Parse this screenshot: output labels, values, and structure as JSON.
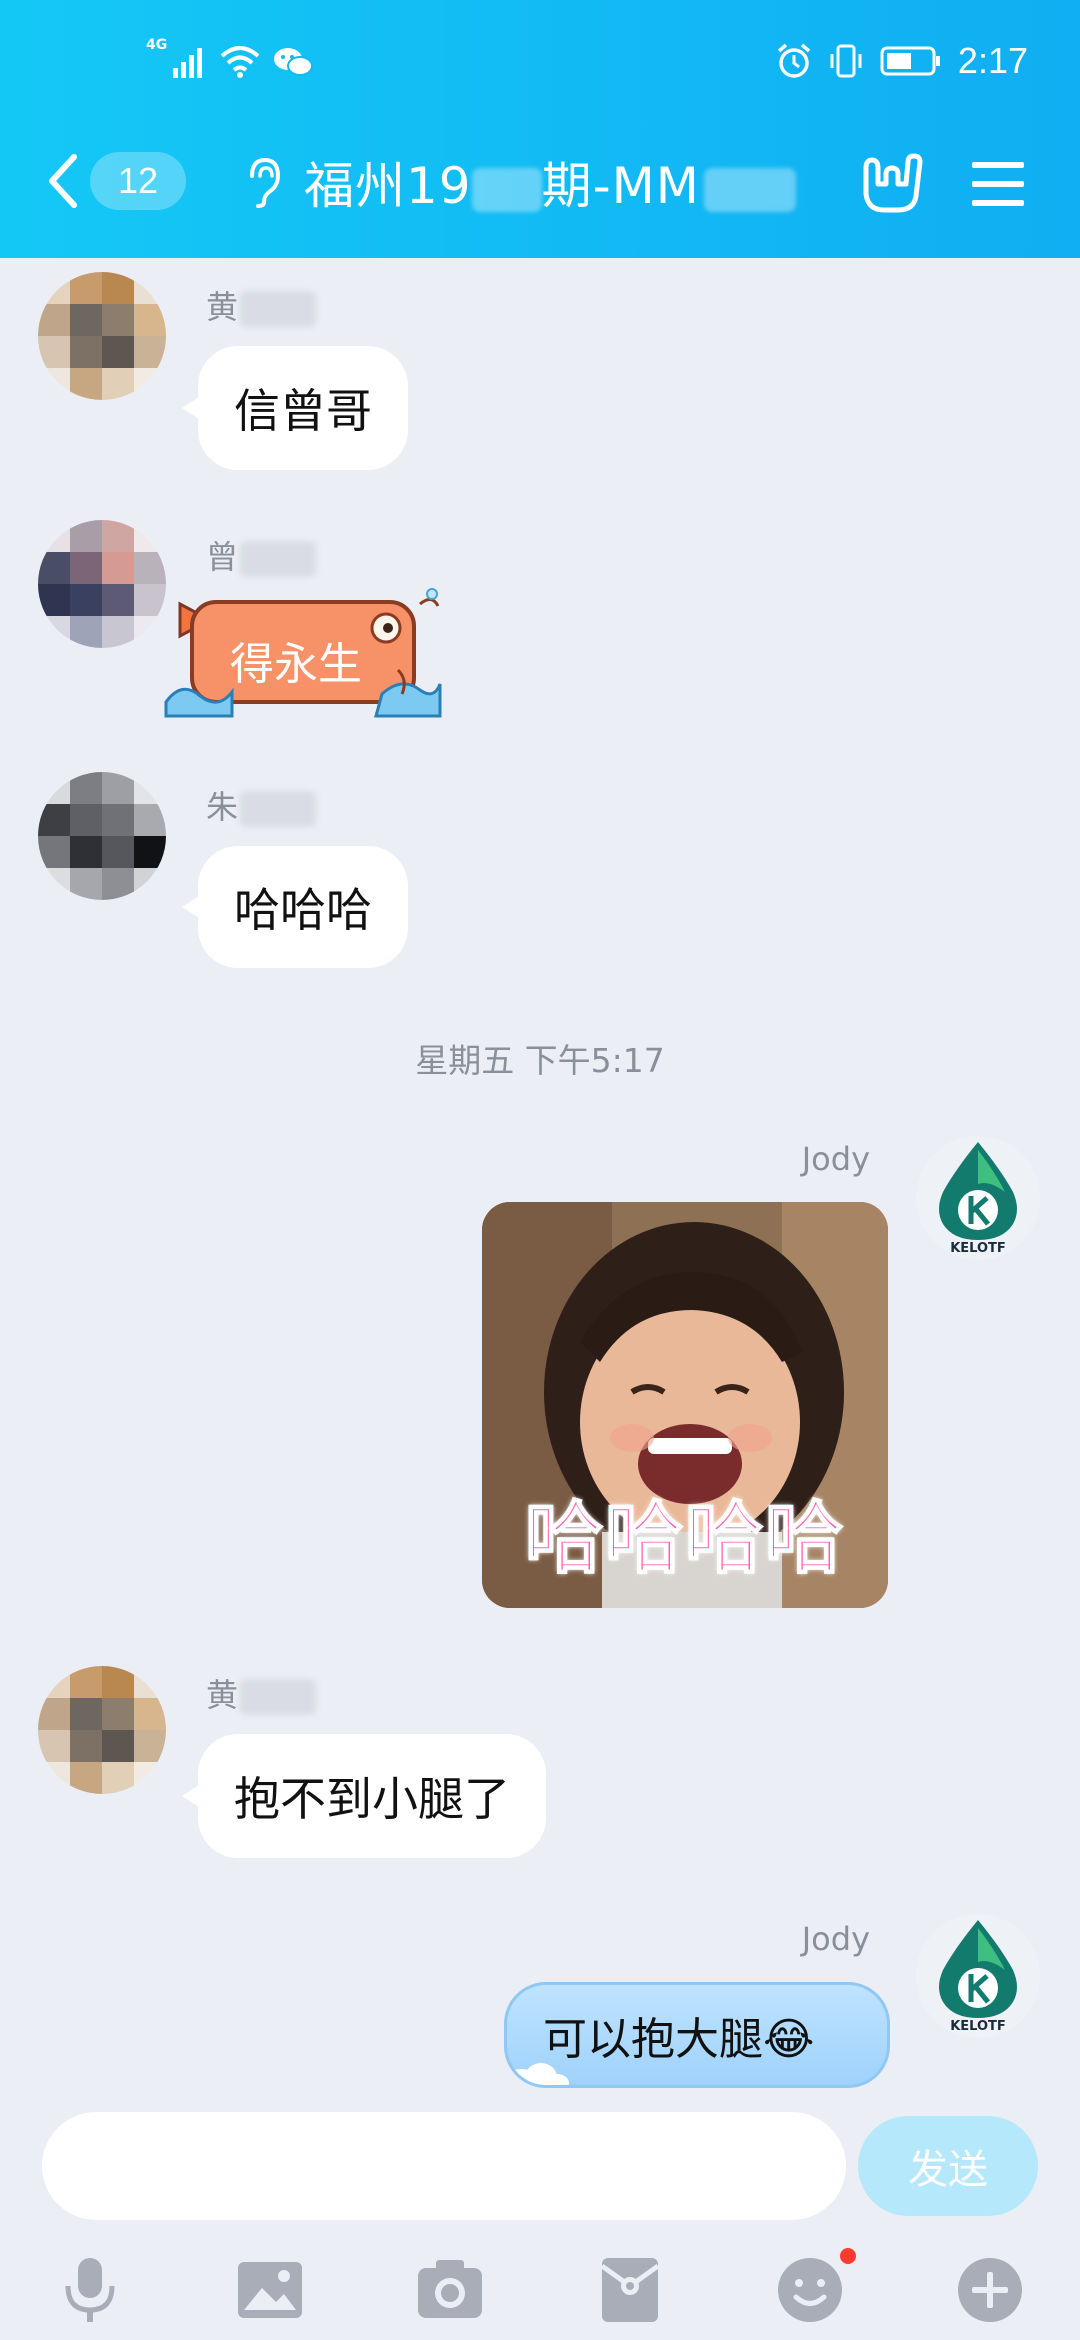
{
  "status_bar": {
    "network": "4G",
    "time": "2:17"
  },
  "header": {
    "unread_count": "12",
    "title_part1": "福州19",
    "title_part2": "期-MM"
  },
  "messages": [
    {
      "sender": "黄",
      "text": "信曾哥"
    },
    {
      "sender": "曾",
      "sticker_text": "得永生"
    },
    {
      "sender": "朱",
      "text": "哈哈哈"
    },
    {
      "timestamp": "星期五 下午5:17"
    },
    {
      "sender": "Jody",
      "image_caption": "哈哈哈哈"
    },
    {
      "sender": "黄",
      "text": "抱不到小腿了"
    },
    {
      "sender": "Jody",
      "text": "可以抱大腿😂"
    }
  ],
  "avatar_logo_text": "KELOTF",
  "input": {
    "placeholder": "",
    "value": "",
    "send_label": "发送"
  },
  "toolbar_icons": [
    "microphone-icon",
    "image-icon",
    "camera-icon",
    "red-packet-icon",
    "emoji-icon",
    "plus-icon"
  ]
}
